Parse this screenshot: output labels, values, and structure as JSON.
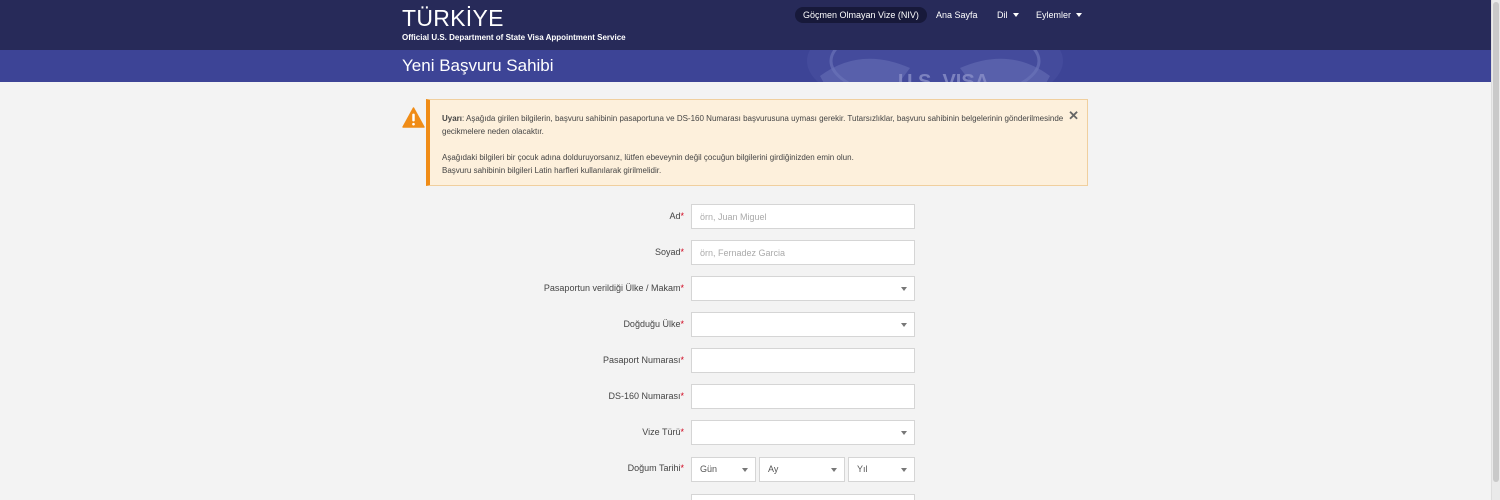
{
  "header": {
    "title": "TÜRKİYE",
    "subtitle": "Official U.S. Department of State Visa Appointment Service",
    "nav": {
      "niv": "Göçmen Olmayan Vize (NIV)",
      "home": "Ana Sayfa",
      "language": "Dil",
      "actions": "Eylemler"
    }
  },
  "page": {
    "title": "Yeni Başvuru Sahibi",
    "seal_text": "U.S. VISA"
  },
  "alert": {
    "label": "Uyarı",
    "line1": ": Aşağıda girilen bilgilerin, başvuru sahibinin pasaportuna ve DS-160 Numarası başvurusuna uyması gerekir. Tutarsızlıklar, başvuru sahibinin belgelerinin gönderilmesinde gecikmelere neden olacaktır.",
    "line2": "Aşağıdaki bilgileri bir çocuk adına dolduruyorsanız, lütfen ebeveynin değil çocuğun bilgilerini girdiğinizden emin olun.",
    "line3": "Başvuru sahibinin bilgileri Latin harfleri kullanılarak girilmelidir.",
    "close": "✕"
  },
  "form": {
    "required_mark": "*",
    "first_name": {
      "label": "Ad",
      "placeholder": "örn, Juan Miguel",
      "value": ""
    },
    "last_name": {
      "label": "Soyad",
      "placeholder": "örn, Fernadez Garcia",
      "value": ""
    },
    "passport_country": {
      "label": "Pasaportun verildiği Ülke / Makam",
      "value": ""
    },
    "birth_country": {
      "label": "Doğduğu Ülke",
      "value": ""
    },
    "passport_number": {
      "label": "Pasaport Numarası",
      "value": ""
    },
    "ds160": {
      "label": "DS-160 Numarası",
      "value": ""
    },
    "visa_type": {
      "label": "Vize Türü",
      "value": ""
    },
    "birth_date": {
      "label": "Doğum Tarihi",
      "day": "Gün",
      "month": "Ay",
      "year": "Yıl"
    }
  },
  "colors": {
    "topbar": "#272a59",
    "subbar": "#3d4496",
    "alert_bg": "#fdf0dc",
    "alert_accent": "#f08c16",
    "required": "#d0021b"
  },
  "icons": {
    "alert": "warning-triangle-icon",
    "close": "close-icon",
    "dropdown": "chevron-down-icon"
  }
}
